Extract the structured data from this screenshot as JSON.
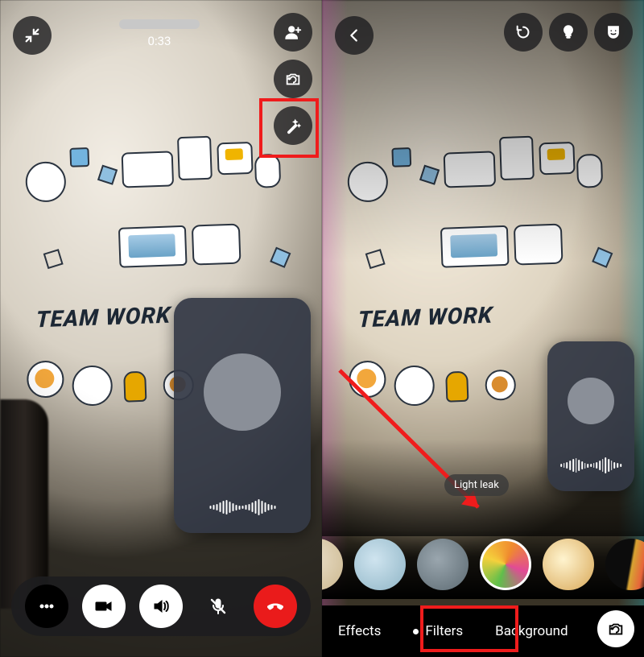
{
  "mural_text": "TEAM WORK",
  "left": {
    "call_timer": "0:33",
    "icons": {
      "minimize": "minimize-icon",
      "add_participant": "person-add-icon",
      "flip_camera": "flip-camera-icon",
      "effects_wand": "magic-wand-icon"
    },
    "callbar": {
      "more": "more-icon",
      "video": "video-on-icon",
      "speaker": "speaker-on-icon",
      "mute": "mic-muted-icon",
      "end": "hangup-icon"
    }
  },
  "right": {
    "icons": {
      "back": "back-icon",
      "reset": "reset-icon",
      "low_light": "lightbulb-icon",
      "face_effects": "face-mask-icon",
      "flip_camera": "flip-camera-icon"
    },
    "selected_filter_label": "Light leak",
    "filter_swatches": [
      {
        "id": "warm",
        "selected": false
      },
      {
        "id": "cool",
        "selected": false
      },
      {
        "id": "mono",
        "selected": false
      },
      {
        "id": "light-leak",
        "selected": true
      },
      {
        "id": "glow",
        "selected": false
      },
      {
        "id": "prism",
        "selected": false
      },
      {
        "id": "noir",
        "selected": false
      }
    ],
    "tabs": {
      "effects": "Effects",
      "filters": "Filters",
      "background": "Background"
    },
    "active_tab": "filters"
  },
  "annotations": {
    "highlight_left": "effects-wand-button",
    "highlight_right": "filters-tab",
    "arrow_target": "selected-filter-swatch"
  }
}
